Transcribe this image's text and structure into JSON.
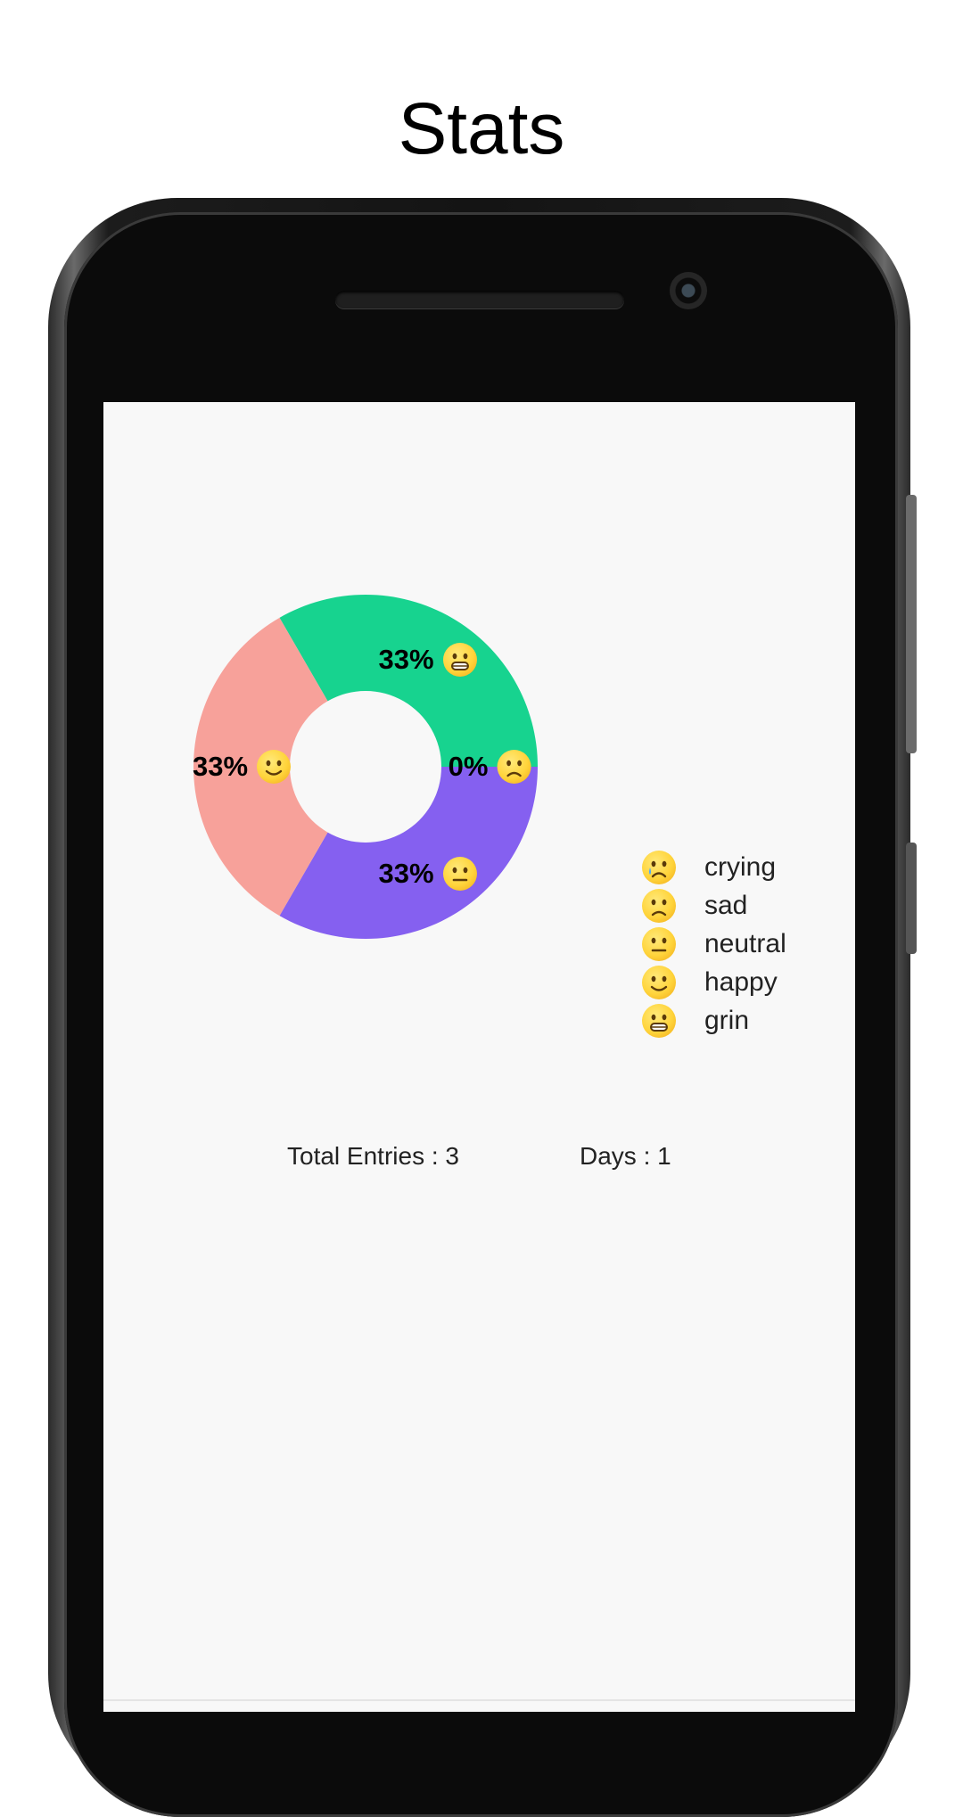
{
  "header": {
    "title": "Stats"
  },
  "chart_data": {
    "type": "pie",
    "donut": true,
    "slices": [
      {
        "category": "grin",
        "value": 33,
        "label": "33%",
        "color": "#17d38f"
      },
      {
        "category": "neutral",
        "value": 33,
        "label": "33%",
        "color": "#8560f0"
      },
      {
        "category": "happy",
        "value": 33,
        "label": "33%",
        "color": "#f7a19a"
      },
      {
        "category": "sad",
        "value": 0,
        "label": "0%",
        "color": "#8e9af0"
      }
    ],
    "legend_position": "right"
  },
  "legend": {
    "items": [
      {
        "label": "crying",
        "icon": "crying-face-icon"
      },
      {
        "label": "sad",
        "icon": "sad-face-icon"
      },
      {
        "label": "neutral",
        "icon": "neutral-face-icon"
      },
      {
        "label": "happy",
        "icon": "happy-face-icon"
      },
      {
        "label": "grin",
        "icon": "grin-face-icon"
      }
    ]
  },
  "stats": {
    "total_entries": "Total Entries : 3",
    "days": "Days : 1"
  }
}
